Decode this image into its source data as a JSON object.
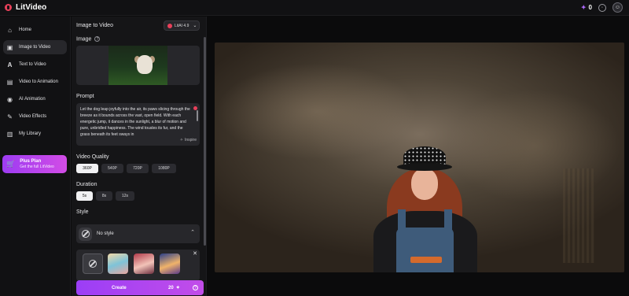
{
  "app": {
    "name": "LitVideo",
    "credits": "0"
  },
  "sidebar": {
    "items": [
      {
        "label": "Home",
        "icon": "home-icon"
      },
      {
        "label": "Image to Video",
        "icon": "image-icon",
        "active": true
      },
      {
        "label": "Text to Video",
        "icon": "text-icon"
      },
      {
        "label": "Video to Animation",
        "icon": "video-icon"
      },
      {
        "label": "AI Animation",
        "icon": "ai-icon"
      },
      {
        "label": "Video Effects",
        "icon": "wand-icon"
      },
      {
        "label": "My Library",
        "icon": "library-icon"
      }
    ],
    "plan": {
      "title": "Plus Plan",
      "subtitle": "Get the full LitVideo"
    }
  },
  "panel": {
    "title": "Image to Video",
    "model": "LitAI 4.9",
    "image_label": "Image",
    "prompt_label": "Prompt",
    "prompt_text": "Let the dog leap joyfully into the air, its paws slicing through the breeze as it bounds across the vast, open field. With each energetic jump, it dances in the sunlight, a blur of motion and pure, unbridled happiness. The wind tousles its fur, and the grass beneath its feet sways in",
    "inspire_label": "Inspire",
    "quality_label": "Video Quality",
    "qualities": [
      "360P",
      "540P",
      "720P",
      "1080P"
    ],
    "duration_label": "Duration",
    "durations": [
      "5s",
      "8s",
      "12s"
    ],
    "style_label": "Style",
    "style_selected": "No style",
    "create_label": "Create",
    "create_cost": "20"
  },
  "colors": {
    "accent": "#9b3ef6",
    "brand": "#e8405a"
  }
}
